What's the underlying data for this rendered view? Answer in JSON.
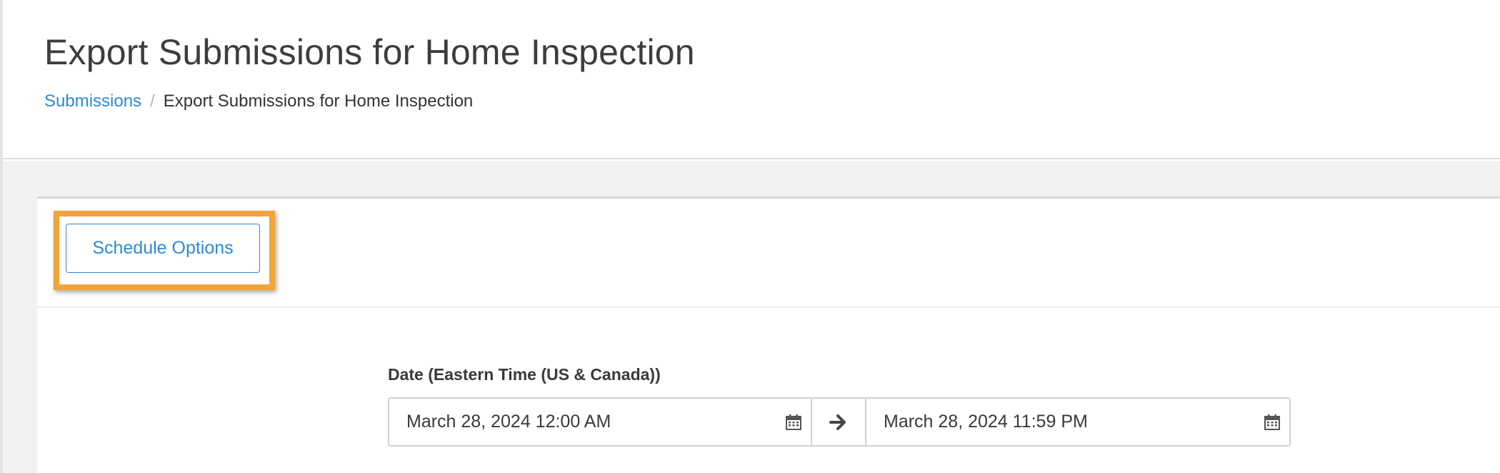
{
  "header": {
    "title": "Export Submissions for Home Inspection",
    "breadcrumb": {
      "link_label": "Submissions",
      "separator": "/",
      "current_label": "Export Submissions for Home Inspection"
    }
  },
  "toolbar": {
    "schedule_options_label": "Schedule Options",
    "highlight_color": "#f0a43a"
  },
  "date_filter": {
    "label": "Date (Eastern Time (US & Canada))",
    "start_value": "March 28, 2024 12:00 AM",
    "end_value": "March 28, 2024 11:59 PM",
    "start_icon": "calendar-icon",
    "end_icon": "calendar-icon",
    "separator_icon": "arrow-right-icon"
  },
  "colors": {
    "accent": "#2d8ad6",
    "text": "#3a3a3a",
    "background": "#f2f2f2"
  }
}
